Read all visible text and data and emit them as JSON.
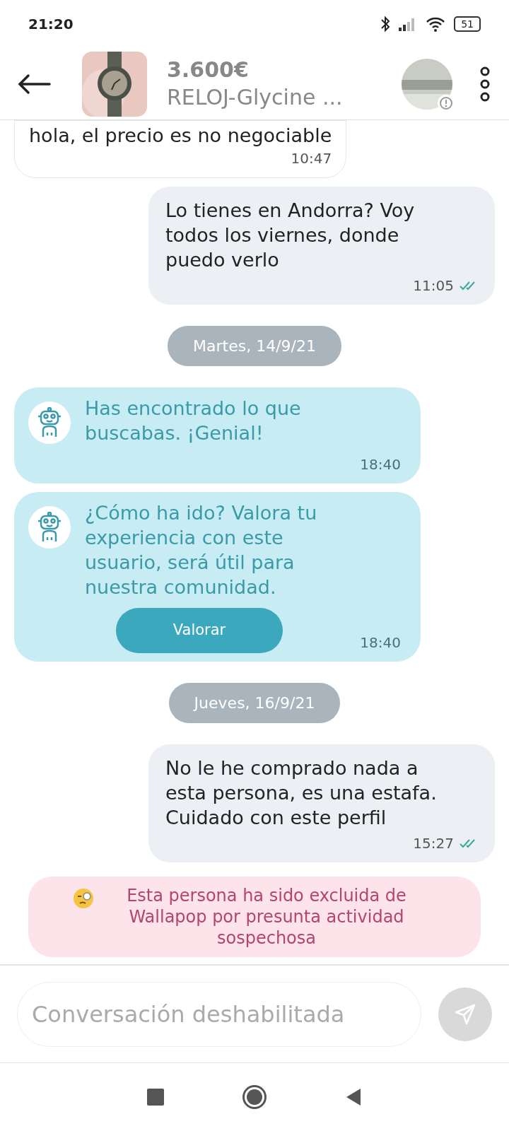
{
  "status_bar": {
    "time": "21:20",
    "battery": "51"
  },
  "header": {
    "price": "3.600€",
    "title": "RELOJ-Glycine ..."
  },
  "messages": [
    {
      "kind": "incoming",
      "text": "hola, el precio es no negociable",
      "time": "10:47"
    },
    {
      "kind": "outgoing",
      "text": "Lo tienes en Andorra? Voy todos los viernes, donde puedo verlo",
      "time": "11:05",
      "read": true
    },
    {
      "kind": "date",
      "text": "Martes, 14/9/21"
    },
    {
      "kind": "bot",
      "text": "Has encontrado lo que buscabas. ¡Genial!",
      "time": "18:40"
    },
    {
      "kind": "bot",
      "text": "¿Cómo ha ido? Valora tu experiencia con este usuario, será útil para nuestra comunidad.",
      "time": "18:40",
      "action": "Valorar"
    },
    {
      "kind": "date",
      "text": "Jueves, 16/9/21"
    },
    {
      "kind": "outgoing",
      "text": "No le he comprado nada a esta persona, es una estafa. Cuidado con este perfil",
      "time": "15:27",
      "read": true
    },
    {
      "kind": "notice",
      "text": "Esta persona ha sido excluida de Wallapop por presunta actividad sospechosa"
    }
  ],
  "composer": {
    "placeholder": "Conversación deshabilitada",
    "disabled": true
  }
}
